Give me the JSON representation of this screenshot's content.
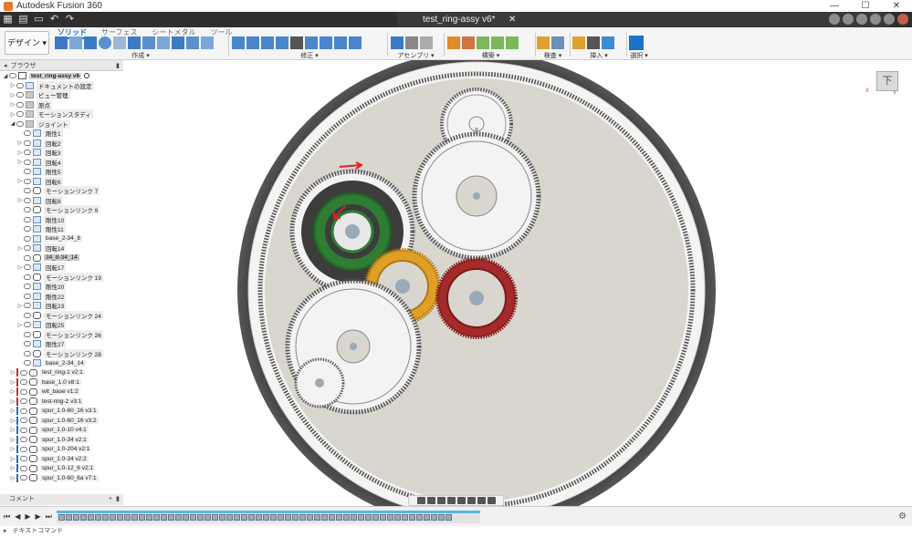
{
  "titlebar": {
    "app_title": "Autodesk Fusion 360",
    "min": "—",
    "max": "☐",
    "close": "✕"
  },
  "doc_tab": {
    "name": "test_ring-assy v6*",
    "close": "✕"
  },
  "ribbon": {
    "workspace": "デザイン ▾",
    "tabs": [
      "ソリッド",
      "サーフェス",
      "シートメタル",
      "ツール"
    ],
    "groups": [
      {
        "label": "作成 ▾"
      },
      {
        "label": "修正 ▾"
      },
      {
        "label": "アセンブリ ▾"
      },
      {
        "label": "構築 ▾"
      },
      {
        "label": "検査 ▾"
      },
      {
        "label": "挿入 ▾"
      },
      {
        "label": "選択 ▾"
      }
    ]
  },
  "browser": {
    "header": "ブラウザ",
    "root": "test_ring-assy v6",
    "items": [
      {
        "label": "ドキュメントの設定",
        "indent": 1,
        "icon": "gear",
        "arrow": "right"
      },
      {
        "label": "ビュー管理",
        "indent": 1,
        "icon": "folder",
        "arrow": "right"
      },
      {
        "label": "原点",
        "indent": 1,
        "icon": "folder",
        "arrow": "right"
      },
      {
        "label": "モーションスタディ",
        "indent": 1,
        "icon": "folder",
        "arrow": "right"
      },
      {
        "label": "ジョイント",
        "indent": 1,
        "icon": "folder",
        "arrow": "down"
      },
      {
        "label": "剛性1",
        "indent": 2,
        "icon": "joint",
        "arrow": ""
      },
      {
        "label": "回転2",
        "indent": 2,
        "icon": "joint",
        "arrow": "right"
      },
      {
        "label": "回転3",
        "indent": 2,
        "icon": "joint",
        "arrow": "right"
      },
      {
        "label": "回転4",
        "indent": 2,
        "icon": "joint",
        "arrow": "right"
      },
      {
        "label": "剛性5",
        "indent": 2,
        "icon": "joint",
        "arrow": ""
      },
      {
        "label": "回転6",
        "indent": 2,
        "icon": "joint",
        "arrow": "right"
      },
      {
        "label": "モーションリンク 7",
        "indent": 2,
        "icon": "link",
        "arrow": ""
      },
      {
        "label": "回転8",
        "indent": 2,
        "icon": "joint",
        "arrow": "right"
      },
      {
        "label": "モーションリンク 9",
        "indent": 2,
        "icon": "link",
        "arrow": ""
      },
      {
        "label": "剛性10",
        "indent": 2,
        "icon": "joint",
        "arrow": ""
      },
      {
        "label": "剛性11",
        "indent": 2,
        "icon": "joint",
        "arrow": ""
      },
      {
        "label": "base_2-34_8",
        "indent": 2,
        "icon": "joint",
        "arrow": ""
      },
      {
        "label": "回転14",
        "indent": 2,
        "icon": "joint",
        "arrow": "right"
      },
      {
        "label": "34_8-34_14",
        "indent": 2,
        "icon": "link",
        "arrow": "",
        "selected": true
      },
      {
        "label": "回転17",
        "indent": 2,
        "icon": "joint",
        "arrow": "right"
      },
      {
        "label": "モーションリンク 19",
        "indent": 2,
        "icon": "link",
        "arrow": ""
      },
      {
        "label": "剛性20",
        "indent": 2,
        "icon": "joint",
        "arrow": ""
      },
      {
        "label": "剛性22",
        "indent": 2,
        "icon": "joint",
        "arrow": ""
      },
      {
        "label": "回転23",
        "indent": 2,
        "icon": "joint",
        "arrow": "right"
      },
      {
        "label": "モーションリンク 24",
        "indent": 2,
        "icon": "link",
        "arrow": ""
      },
      {
        "label": "回転25",
        "indent": 2,
        "icon": "joint",
        "arrow": "right"
      },
      {
        "label": "モーションリンク 26",
        "indent": 2,
        "icon": "link",
        "arrow": ""
      },
      {
        "label": "剛性27",
        "indent": 2,
        "icon": "joint",
        "arrow": ""
      },
      {
        "label": "モーションリンク 28",
        "indent": 2,
        "icon": "link",
        "arrow": ""
      },
      {
        "label": "base_2-34_14",
        "indent": 2,
        "icon": "joint",
        "arrow": ""
      },
      {
        "label": "test_ring-1 v2:1",
        "indent": 1,
        "icon": "component",
        "arrow": "right",
        "color": "#b03a2e"
      },
      {
        "label": "base_1.0 v8:1",
        "indent": 1,
        "icon": "component",
        "arrow": "right",
        "color": "#b03a2e"
      },
      {
        "label": "wit_base v1:2",
        "indent": 1,
        "icon": "component",
        "arrow": "right",
        "color": "#b03a2e"
      },
      {
        "label": "test-ring-2 v3:1",
        "indent": 1,
        "icon": "component",
        "arrow": "right",
        "color": "#b03a2e"
      },
      {
        "label": "spur_1.0-60_16 v3:1",
        "indent": 1,
        "icon": "component",
        "arrow": "right",
        "color": "#2b6cb0"
      },
      {
        "label": "spur_1.0-60_16 v3:2",
        "indent": 1,
        "icon": "component",
        "arrow": "right",
        "color": "#2b6cb0"
      },
      {
        "label": "spur_1.0-10 v4:1",
        "indent": 1,
        "icon": "component",
        "arrow": "right",
        "color": "#2b6cb0"
      },
      {
        "label": "spur_1.0-34 v2:1",
        "indent": 1,
        "icon": "component",
        "arrow": "right",
        "color": "#2b6cb0"
      },
      {
        "label": "spur_1.0-204 v2:1",
        "indent": 1,
        "icon": "component",
        "arrow": "right",
        "color": "#2b6cb0"
      },
      {
        "label": "spur_1.0-34 v2:2",
        "indent": 1,
        "icon": "component",
        "arrow": "right",
        "color": "#2b6cb0"
      },
      {
        "label": "spur_1.0-12_6 v2:1",
        "indent": 1,
        "icon": "component",
        "arrow": "right",
        "color": "#2b6cb0"
      },
      {
        "label": "spur_1.0-60_6a v7:1",
        "indent": 1,
        "icon": "component",
        "arrow": "right",
        "color": "#2b6cb0"
      }
    ]
  },
  "viewcube": {
    "face": "下",
    "x_label": "X",
    "y_label": "Y"
  },
  "comment_bar": {
    "label": "コメント"
  },
  "text_command": {
    "label": "テキストコマンド"
  }
}
